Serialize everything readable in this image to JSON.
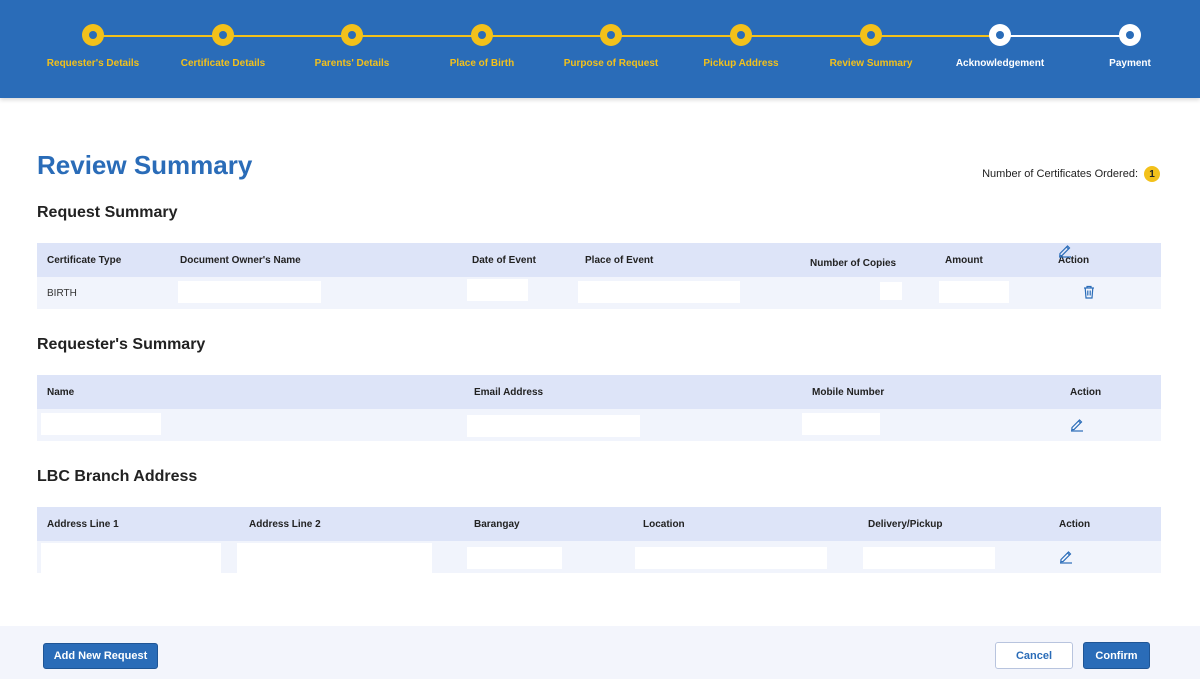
{
  "colors": {
    "primary_blue": "#2a6cb8",
    "step_completed_yellow": "#f3c11b",
    "step_pending_white": "#ffffff",
    "table_header_bg": "#dde4f8",
    "table_row_bg": "#f1f4fc"
  },
  "progress": {
    "steps": [
      {
        "label": "Requester's Details",
        "state": "completed"
      },
      {
        "label": "Certificate Details",
        "state": "completed"
      },
      {
        "label": "Parents' Details",
        "state": "completed"
      },
      {
        "label": "Place of Birth",
        "state": "completed"
      },
      {
        "label": "Purpose of Request",
        "state": "completed"
      },
      {
        "label": "Pickup Address",
        "state": "completed"
      },
      {
        "label": "Review Summary",
        "state": "completed"
      },
      {
        "label": "Acknowledgement",
        "state": "pending"
      },
      {
        "label": "Payment",
        "state": "pending"
      }
    ]
  },
  "page": {
    "title": "Review Summary",
    "cert_count_label": "Number of Certificates Ordered:",
    "cert_count": "1"
  },
  "request_summary": {
    "title": "Request Summary",
    "columns": [
      "Certificate Type",
      "Document Owner's Name",
      "Date of Event",
      "Place of Event",
      "Number of Copies",
      "Amount",
      "Action"
    ],
    "rows": [
      {
        "certificate_type": "BIRTH"
      }
    ],
    "actions": [
      "edit-icon",
      "trash-icon"
    ]
  },
  "requester_summary": {
    "title": "Requester's Summary",
    "columns": [
      "Name",
      "Email Address",
      "Mobile Number",
      "Action"
    ],
    "actions": [
      "edit-icon"
    ]
  },
  "branch_address": {
    "title": "LBC Branch Address",
    "columns": [
      "Address Line 1",
      "Address Line 2",
      "Barangay",
      "Location",
      "Delivery/Pickup",
      "Action"
    ],
    "actions": [
      "edit-icon"
    ]
  },
  "footer": {
    "add_new_label": "Add New Request",
    "cancel_label": "Cancel",
    "confirm_label": "Confirm"
  }
}
